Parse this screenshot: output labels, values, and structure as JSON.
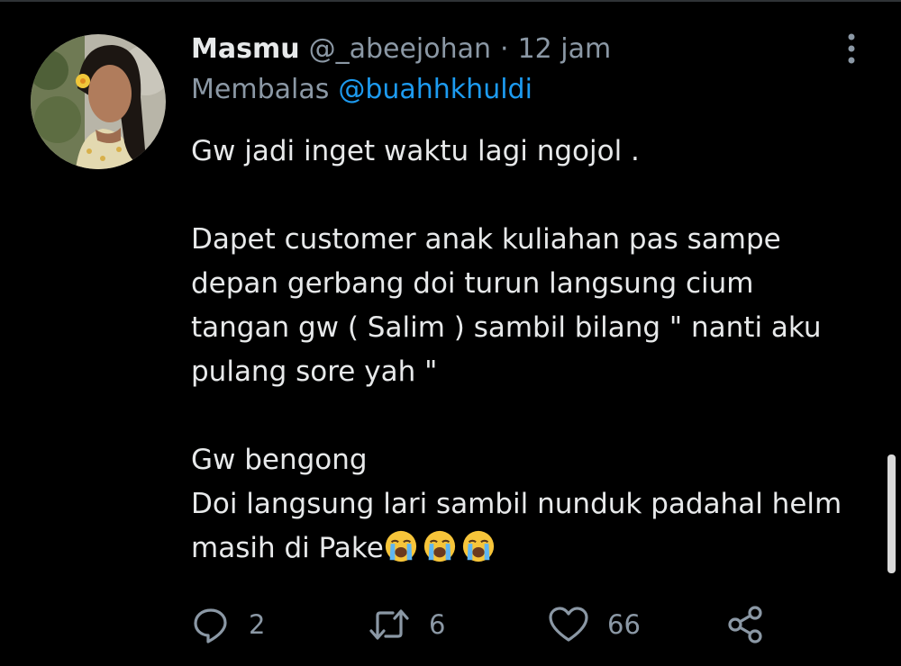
{
  "tweet": {
    "display_name": "Masmu",
    "handle": "@_abeejohan",
    "separator": "·",
    "time": "12 jam",
    "reply_prefix": "Membalas",
    "reply_to": "@buahhkhuldi",
    "lines": {
      "l1": "Gw jadi inget waktu lagi ngojol .",
      "l2": "Dapet customer anak kuliahan pas sampe",
      "l3": "depan gerbang doi turun langsung cium",
      "l4": "tangan gw ( Salim ) sambil bilang \" nanti aku",
      "l5": "pulang sore yah \"",
      "l6": "Gw bengong",
      "l7": "Doi langsung lari sambil nunduk padahal helm",
      "l8": "masih di Pake"
    },
    "emojis": [
      "loudly-crying-face",
      "loudly-crying-face",
      "loudly-crying-face"
    ]
  },
  "actions": {
    "reply_count": "2",
    "retweet_count": "6",
    "like_count": "66"
  },
  "icons": {
    "reply": "reply-icon",
    "retweet": "retweet-icon",
    "like": "heart-icon",
    "share": "share-icon",
    "more": "more-vertical-icon"
  },
  "colors": {
    "background": "#000000",
    "text": "#e7e9ea",
    "secondary": "#8b98a5",
    "accent": "#1d9bf0"
  }
}
